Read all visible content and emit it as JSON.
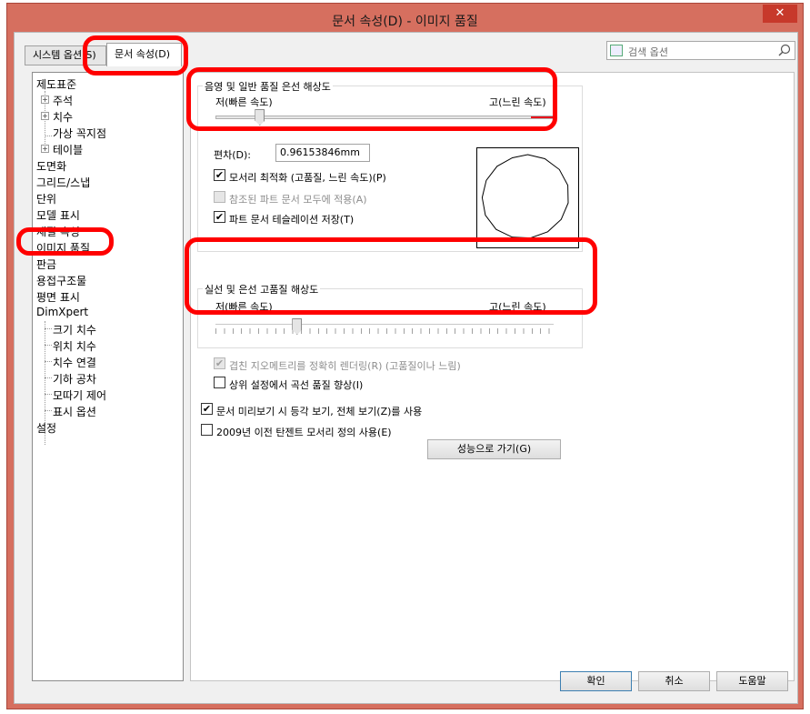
{
  "window": {
    "title": "문서 속성(D) - 이미지 품질",
    "close_glyph": "✕"
  },
  "tabs": [
    {
      "label": "시스템 옵션(S)"
    },
    {
      "label": "문서 속성(D)"
    }
  ],
  "search": {
    "placeholder": "검색 옵션"
  },
  "tree": {
    "items": [
      {
        "label": "제도표준"
      },
      {
        "label": "주석",
        "expander": "+"
      },
      {
        "label": "치수",
        "expander": "+"
      },
      {
        "label": "가상 꼭지점"
      },
      {
        "label": "테이블",
        "expander": "+"
      },
      {
        "label": "도면화"
      },
      {
        "label": "그리드/스냅"
      },
      {
        "label": "단위"
      },
      {
        "label": "모델 표시"
      },
      {
        "label": "재질 속성"
      },
      {
        "label": "이미지 품질"
      },
      {
        "label": "판금"
      },
      {
        "label": "용접구조물"
      },
      {
        "label": "평면 표시"
      },
      {
        "label": "DimXpert"
      },
      {
        "label": "크기 치수"
      },
      {
        "label": "위치 치수"
      },
      {
        "label": "치수 연결"
      },
      {
        "label": "기하 공차"
      },
      {
        "label": "모따기 제어"
      },
      {
        "label": "표시 옵션"
      },
      {
        "label": "설정"
      }
    ]
  },
  "shaded_group": {
    "title": "음영 및 일반 품질 은선 해상도",
    "low_label": "저(빠른 속도)",
    "high_label": "고(느린 속도)",
    "slider_value": 0.13,
    "deviation_label": "편차(D):",
    "deviation_value": "0.96153846mm",
    "options": [
      {
        "label": "모서리 최적화 (고품질, 느린 속도)(P)",
        "checked": true,
        "enabled": true
      },
      {
        "label": "참조된 파트 문서 모두에 적용(A)",
        "checked": false,
        "enabled": false
      },
      {
        "label": "파트 문서 테슬레이션 저장(T)",
        "checked": true,
        "enabled": true
      }
    ]
  },
  "wireframe_group": {
    "title": "실선 및 은선 고품질 해상도",
    "low_label": "저(빠른 속도)",
    "high_label": "고(느린 속도)",
    "slider_value": 0.24,
    "options": [
      {
        "label": "겹친 지오메트리를 정확히 렌더링(R) (고품질이나 느림)",
        "checked": true,
        "enabled": false
      },
      {
        "label": "상위 설정에서 곡선 품질 향상(I)",
        "checked": false,
        "enabled": true
      }
    ]
  },
  "extra_options": [
    {
      "label": "문서 미리보기 시 등각 보기, 전체 보기(Z)를 사용",
      "checked": true
    },
    {
      "label": "2009년 이전 탄젠트 모서리 정의 사용(E)",
      "checked": false
    }
  ],
  "goto_button": "성능으로 가기(G)",
  "footer": {
    "ok": "확인",
    "cancel": "취소",
    "help": "도움말"
  },
  "colors": {
    "title_bar": "#d66f5f",
    "slider_fill": "#e8121b",
    "highlight": "#ff0000"
  },
  "check_glyph": "✔"
}
